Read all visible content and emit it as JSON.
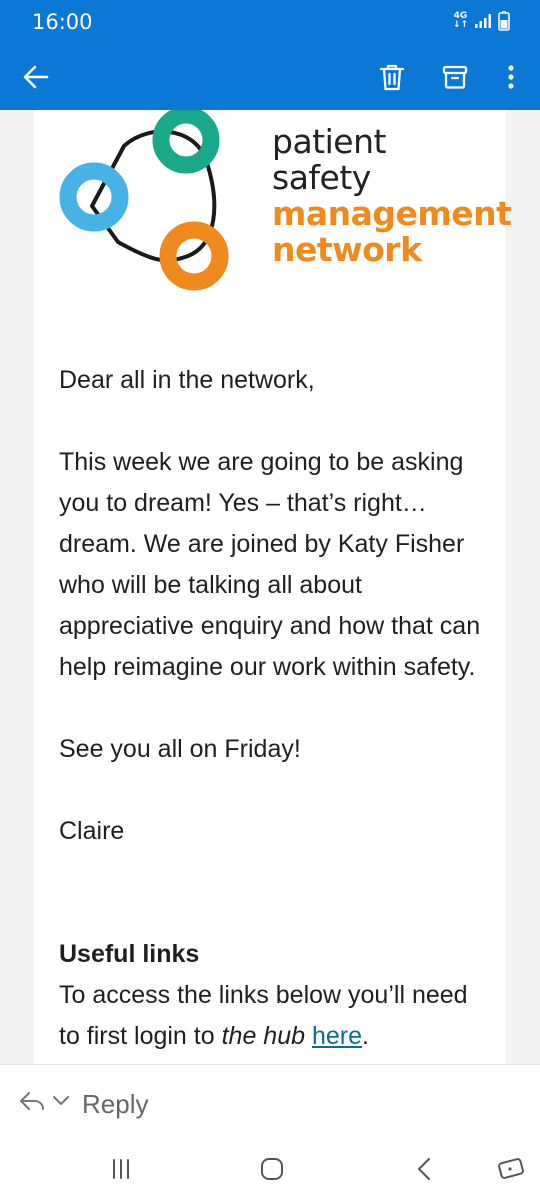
{
  "status_bar": {
    "time": "16:00",
    "network_label": "4G",
    "network_icon": "signal-icon",
    "battery_icon": "battery-icon"
  },
  "app_bar": {
    "back_icon": "arrow-back-icon",
    "delete_icon": "trash-icon",
    "archive_icon": "archive-icon",
    "more_icon": "more-vertical-icon",
    "background_color": "#0a78d4"
  },
  "logo": {
    "line1": "patient",
    "line2": "safety",
    "line3": "management",
    "line4": "network",
    "colors": {
      "green": "#1aa88a",
      "blue": "#45b3e6",
      "orange": "#f08a1e"
    }
  },
  "email": {
    "greeting": "Dear all in the network,",
    "paragraph": "This week we are going to be asking you to dream! Yes – that’s right… dream. We are joined by Katy Fisher who will be talking all about appreciative enquiry and how that can help reimagine our work within safety.",
    "closing": "See you all on Friday!",
    "signature": "Claire",
    "useful_links_title": "Useful links",
    "links_intro": "To access the links below you’ll need to first login to",
    "hub_text": "the hub",
    "here_link": "here",
    "period": "."
  },
  "reply_bar": {
    "reply_icon": "reply-icon",
    "chevron_icon": "chevron-down-icon",
    "reply_label": "Reply"
  },
  "nav_bar": {
    "recents_icon": "recents-icon",
    "home_icon": "home-icon",
    "back_icon": "nav-back-icon",
    "rotate_icon": "rotate-icon"
  }
}
